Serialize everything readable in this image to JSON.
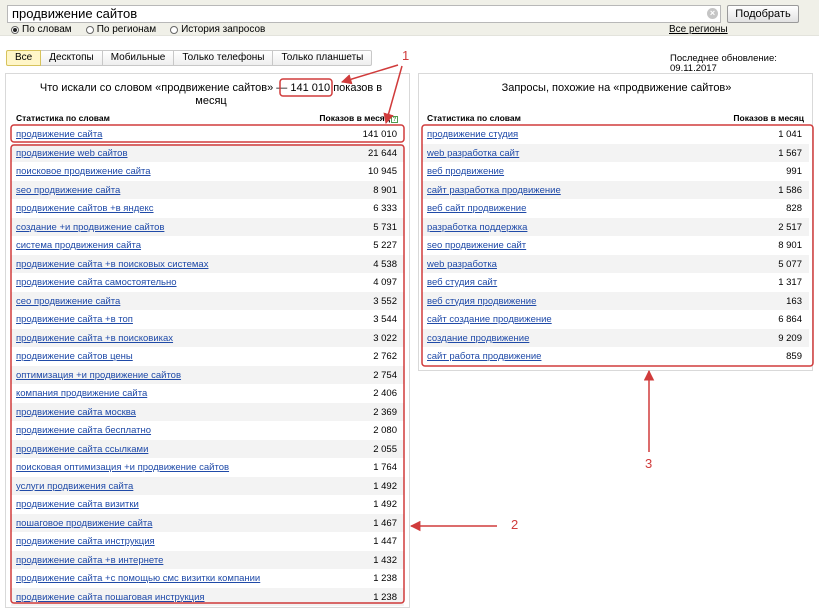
{
  "search": {
    "query": "продвижение сайтов",
    "clear_icon": "close-icon",
    "submit_label": "Подобрать",
    "modes": [
      {
        "label": "По словам",
        "selected": true
      },
      {
        "label": "По регионам",
        "selected": false
      },
      {
        "label": "История запросов",
        "selected": false
      }
    ],
    "regions_link": "Все регионы"
  },
  "device_tabs": [
    "Все",
    "Десктопы",
    "Мобильные",
    "Только телефоны",
    "Только планшеты"
  ],
  "active_tab": "Все",
  "last_update": "Последнее обновление: 09.11.2017",
  "left": {
    "title_prefix": "Что искали со словом «продвижение сайтов» —",
    "title_count": "141 010",
    "title_suffix": "показов в",
    "title_line2": "месяц",
    "col_query": "Статистика по словам",
    "col_count": "Показов в месяц",
    "rows": [
      {
        "q": "продвижение сайта",
        "v": "141 010"
      },
      {
        "q": "продвижение web сайтов",
        "v": "21 644"
      },
      {
        "q": "поисковое продвижение сайта",
        "v": "10 945"
      },
      {
        "q": "seo продвижение сайта",
        "v": "8 901"
      },
      {
        "q": "продвижение сайтов +в яндекс",
        "v": "6 333"
      },
      {
        "q": "создание +и продвижение сайтов",
        "v": "5 731"
      },
      {
        "q": "система продвижения сайта",
        "v": "5 227"
      },
      {
        "q": "продвижение сайта +в поисковых системах",
        "v": "4 538"
      },
      {
        "q": "продвижение сайта самостоятельно",
        "v": "4 097"
      },
      {
        "q": "сео продвижение сайта",
        "v": "3 552"
      },
      {
        "q": "продвижение сайта +в топ",
        "v": "3 544"
      },
      {
        "q": "продвижение сайта +в поисковиках",
        "v": "3 022"
      },
      {
        "q": "продвижение сайтов цены",
        "v": "2 762"
      },
      {
        "q": "оптимизация +и продвижение сайтов",
        "v": "2 754"
      },
      {
        "q": "компания продвижение сайта",
        "v": "2 406"
      },
      {
        "q": "продвижение сайта москва",
        "v": "2 369"
      },
      {
        "q": "продвижение сайта бесплатно",
        "v": "2 080"
      },
      {
        "q": "продвижение сайта ссылками",
        "v": "2 055"
      },
      {
        "q": "поисковая оптимизация +и продвижение сайтов",
        "v": "1 764"
      },
      {
        "q": "услуги продвижения сайта",
        "v": "1 492"
      },
      {
        "q": "продвижение сайта визитки",
        "v": "1 492"
      },
      {
        "q": "пошаговое продвижение сайта",
        "v": "1 467"
      },
      {
        "q": "продвижение сайта инструкция",
        "v": "1 447"
      },
      {
        "q": "продвижение сайта +в интернете",
        "v": "1 432"
      },
      {
        "q": "продвижение сайта +с помощью смс визитки компании",
        "v": "1 238"
      },
      {
        "q": "продвижение сайта пошаговая инструкция",
        "v": "1 238"
      }
    ]
  },
  "right": {
    "title": "Запросы, похожие на «продвижение сайтов»",
    "col_query": "Статистика по словам",
    "col_count": "Показов в месяц",
    "rows": [
      {
        "q": "продвижение студия",
        "v": "1 041"
      },
      {
        "q": "web разработка сайт",
        "v": "1 567"
      },
      {
        "q": "веб продвижение",
        "v": "991"
      },
      {
        "q": "сайт разработка продвижение",
        "v": "1 586"
      },
      {
        "q": "веб сайт продвижение",
        "v": "828"
      },
      {
        "q": "разработка поддержка",
        "v": "2 517"
      },
      {
        "q": "seo продвижение сайт",
        "v": "8 901"
      },
      {
        "q": "web разработка",
        "v": "5 077"
      },
      {
        "q": "веб студия сайт",
        "v": "1 317"
      },
      {
        "q": "веб студия продвижение",
        "v": "163"
      },
      {
        "q": "сайт создание продвижение",
        "v": "6 864"
      },
      {
        "q": "создание продвижение",
        "v": "9 209"
      },
      {
        "q": "сайт работа продвижение",
        "v": "859"
      }
    ]
  },
  "annotations": {
    "color": "#d03b3b",
    "labels": [
      "1",
      "2",
      "3"
    ]
  }
}
